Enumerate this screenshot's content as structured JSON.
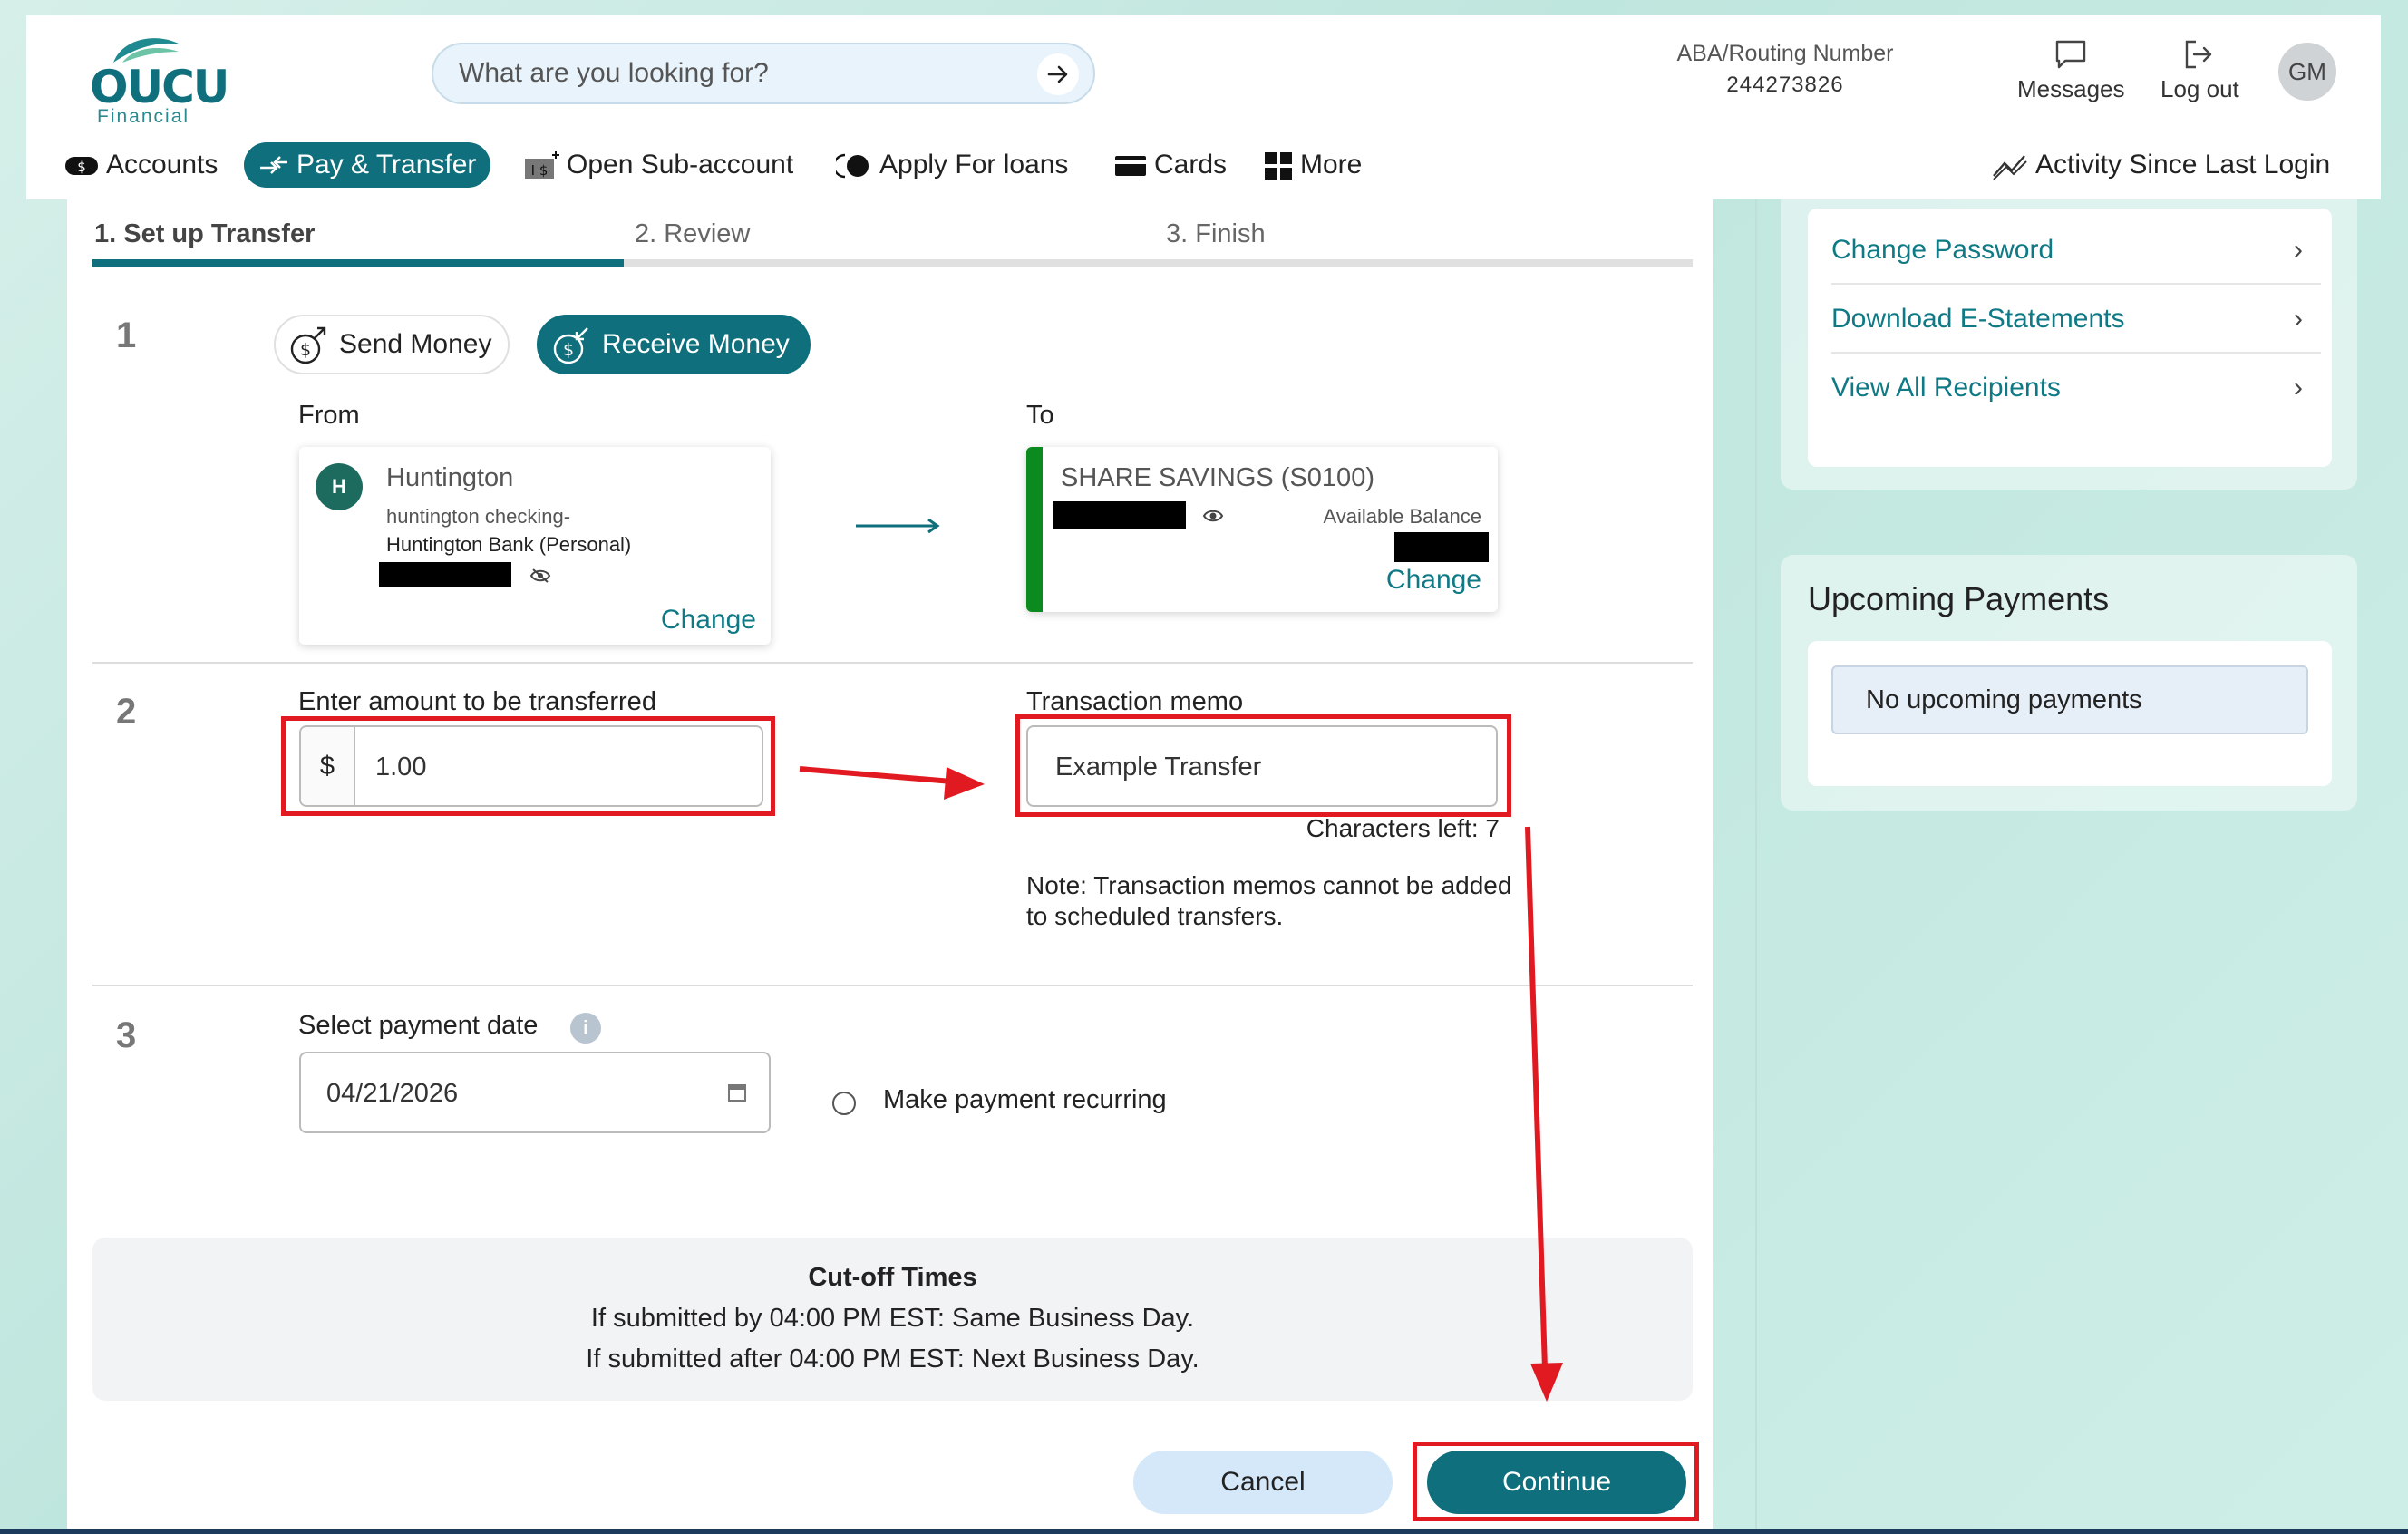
{
  "header": {
    "logo_text": "OUCU",
    "logo_sub": "Financial",
    "search_placeholder": "What are you looking for?",
    "routing_label": "ABA/Routing Number",
    "routing_number": "244273826",
    "messages_label": "Messages",
    "logout_label": "Log out",
    "avatar_initials": "GM"
  },
  "nav": {
    "accounts": "Accounts",
    "pay_transfer": "Pay & Transfer",
    "open_sub": "Open Sub-account",
    "apply_loans": "Apply For loans",
    "cards": "Cards",
    "more": "More",
    "activity": "Activity Since Last Login"
  },
  "steps": [
    "1. Set up Transfer",
    "2. Review",
    "3. Finish"
  ],
  "progress_fraction": 0.333,
  "section1": {
    "number": "1",
    "send_money": "Send Money",
    "receive_money": "Receive Money",
    "from_label": "From",
    "to_label": "To",
    "from_card": {
      "avatar": "H",
      "name": "Huntington",
      "sub1": "huntington checking-",
      "sub2": "Huntington Bank (Personal)",
      "change": "Change"
    },
    "to_card": {
      "name": "SHARE SAVINGS (S0100)",
      "available": "Available Balance",
      "change": "Change"
    }
  },
  "section2": {
    "number": "2",
    "amount_label": "Enter amount to be transferred",
    "currency": "$",
    "amount": "1.00",
    "memo_label": "Transaction memo",
    "memo": "Example Transfer",
    "chars_left": "Characters left: 7",
    "note": "Note: Transaction memos cannot be added to scheduled transfers."
  },
  "section3": {
    "number": "3",
    "date_label": "Select payment date",
    "date": "04/21/2026",
    "recurring_label": "Make payment recurring"
  },
  "cutoff": {
    "title": "Cut-off Times",
    "line1": "If submitted by 04:00 PM EST: Same Business Day.",
    "line2": "If submitted after 04:00 PM EST: Next Business Day."
  },
  "buttons": {
    "cancel": "Cancel",
    "continue": "Continue"
  },
  "sidebar": {
    "links": [
      "Change Password",
      "Download E-Statements",
      "View All Recipients"
    ],
    "upcoming_title": "Upcoming Payments",
    "upcoming_empty": "No upcoming payments"
  },
  "colors": {
    "brand": "#0f6f7c",
    "annotation_red": "#e11a22",
    "link": "#0f7a85"
  }
}
